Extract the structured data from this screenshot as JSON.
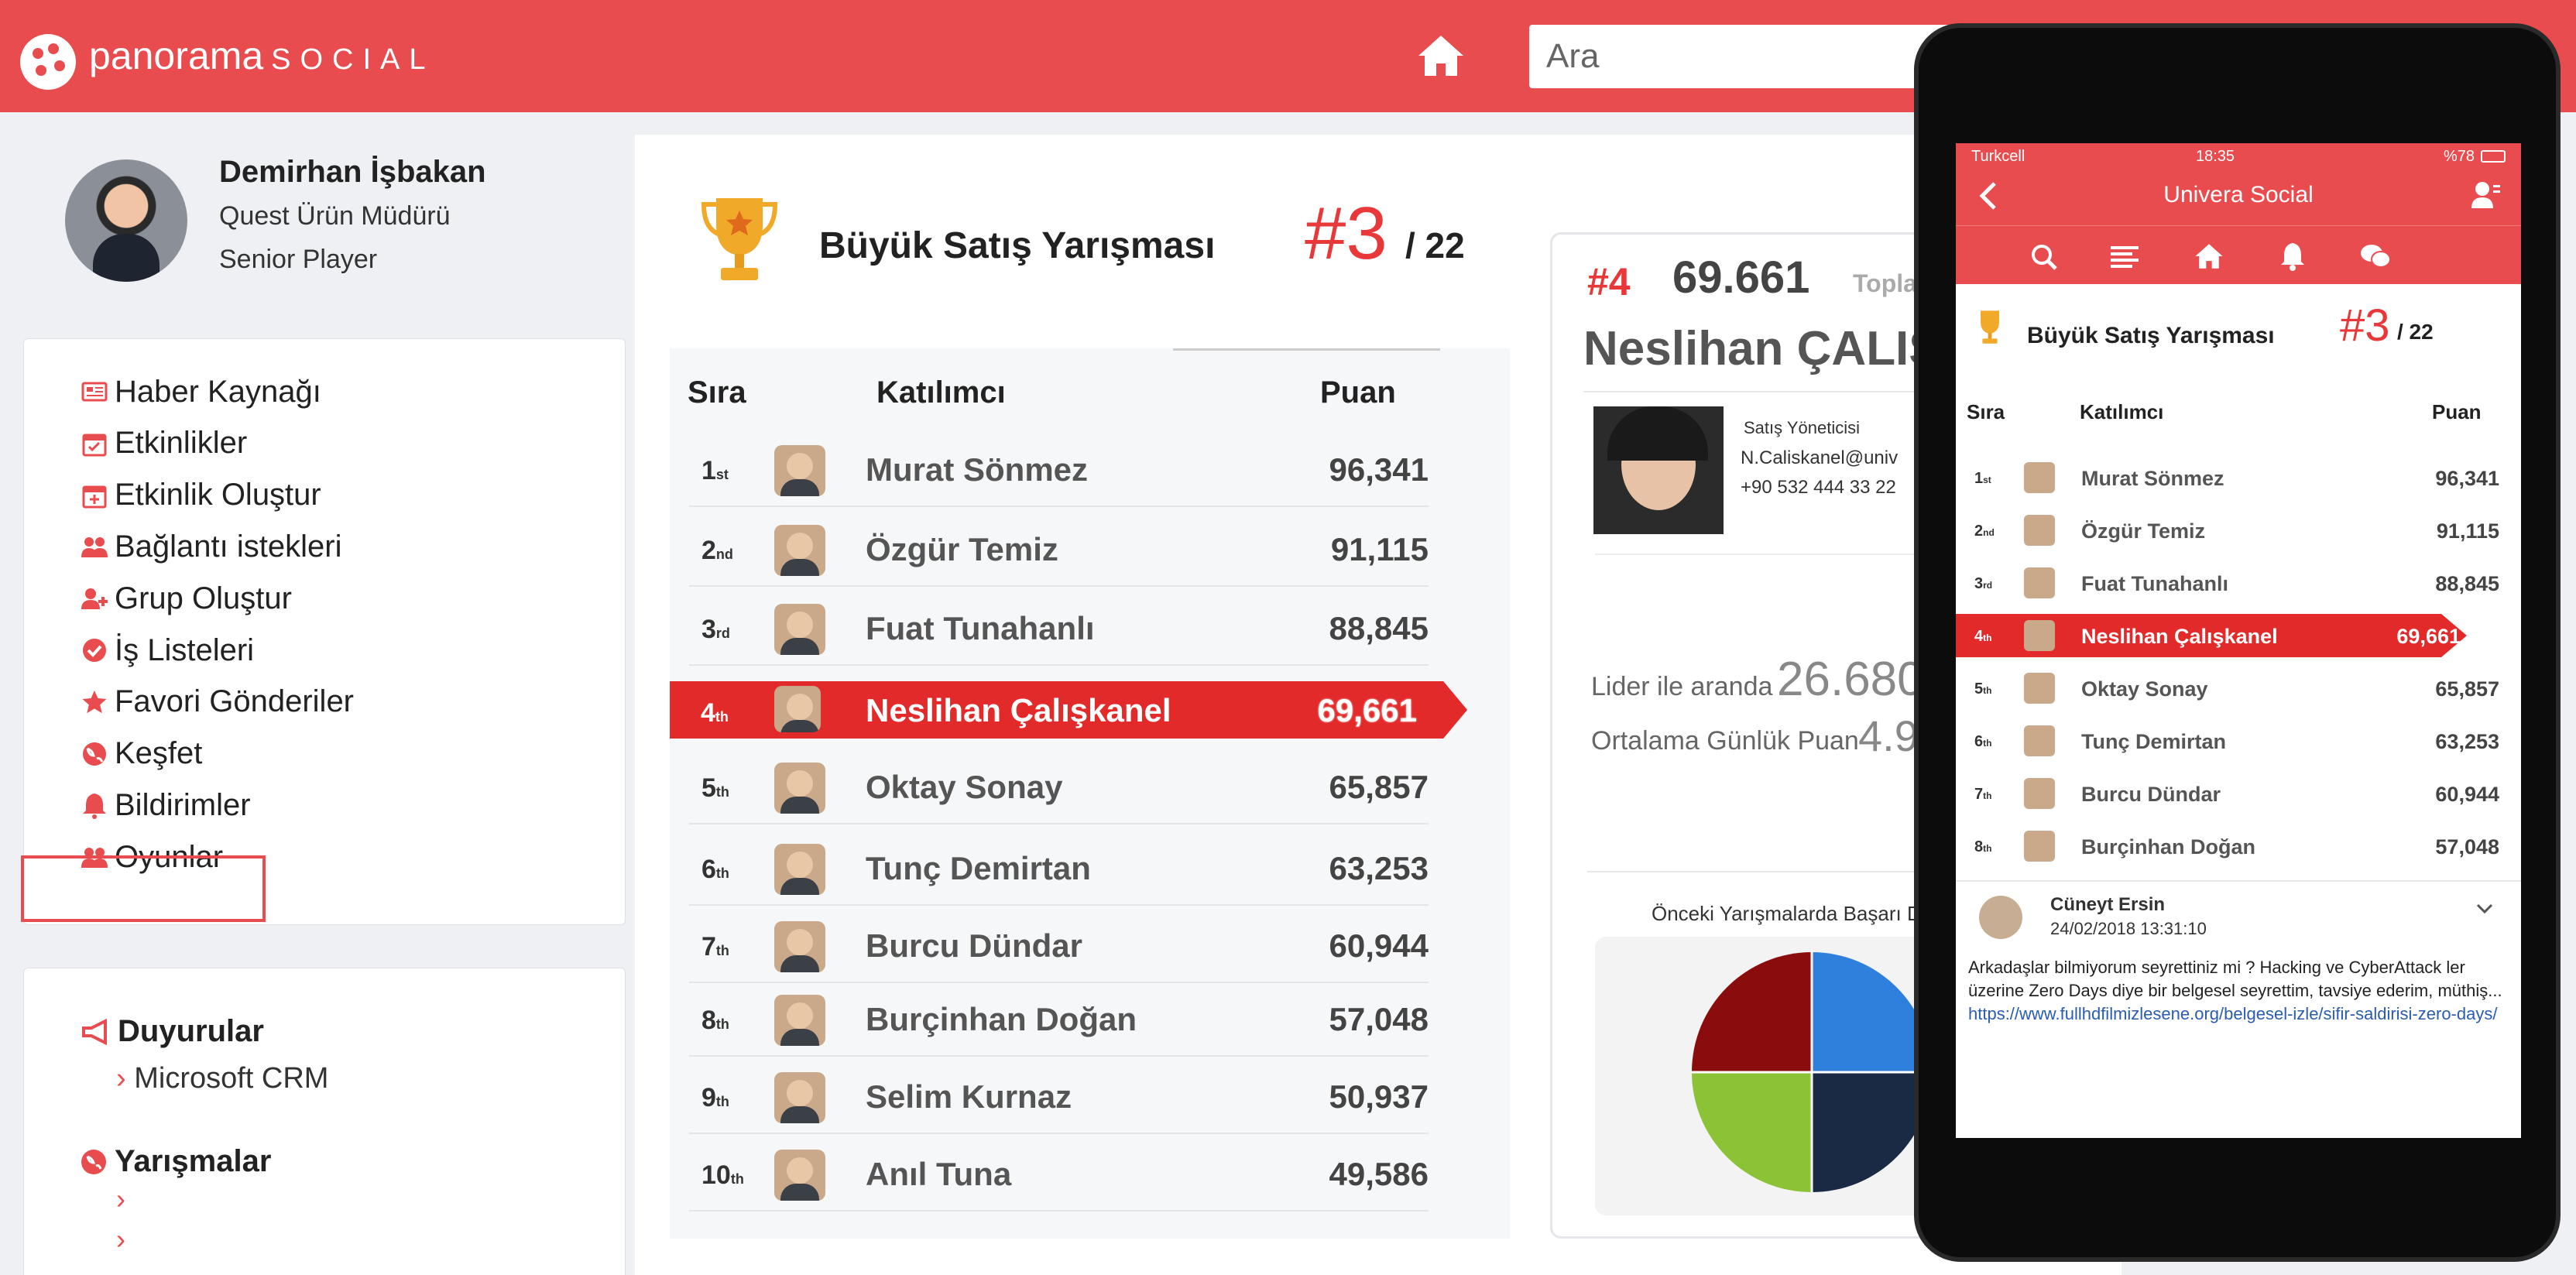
{
  "app": {
    "logo_main": "panorama",
    "logo_sub": "SOCIAL",
    "search_placeholder": "Ara"
  },
  "colors": {
    "brand": "#e94c4e",
    "highlight": "#e32a2a",
    "rank_accent": "#e8383a"
  },
  "profile": {
    "name": "Demirhan İşbakan",
    "title": "Quest Ürün Müdürü",
    "level": "Senior Player"
  },
  "menu": [
    {
      "label": "Haber Kaynağı",
      "icon": "newspaper-icon"
    },
    {
      "label": "Etkinlikler",
      "icon": "calendar-icon"
    },
    {
      "label": "Etkinlik Oluştur",
      "icon": "calendar-plus-icon"
    },
    {
      "label": "Bağlantı istekleri",
      "icon": "users-icon"
    },
    {
      "label": "Grup Oluştur",
      "icon": "user-plus-icon"
    },
    {
      "label": "İş Listeleri",
      "icon": "check-circle-icon"
    },
    {
      "label": "Favori Gönderiler",
      "icon": "star-icon"
    },
    {
      "label": "Keşfet",
      "icon": "globe-icon"
    },
    {
      "label": "Bildirimler",
      "icon": "bell-icon"
    },
    {
      "label": "Oyunlar",
      "icon": "users-icon",
      "selected": true
    }
  ],
  "announcements": {
    "title": "Duyurular",
    "links": [
      "Microsoft CRM"
    ]
  },
  "contests": {
    "title": "Yarışmalar"
  },
  "competition": {
    "title": "Büyük Satış Yarışması",
    "rank": "#3",
    "total": "/ 22"
  },
  "leaderboard": {
    "headers": {
      "rank": "Sıra",
      "participant": "Katılımcı",
      "points": "Puan"
    },
    "rows": [
      {
        "rank": "1",
        "suffix": "st",
        "name": "Murat Sönmez",
        "points": "96,341"
      },
      {
        "rank": "2",
        "suffix": "nd",
        "name": "Özgür Temiz",
        "points": "91,115"
      },
      {
        "rank": "3",
        "suffix": "rd",
        "name": "Fuat Tunahanlı",
        "points": "88,845"
      },
      {
        "rank": "4",
        "suffix": "th",
        "name": "Neslihan Çalışkanel",
        "points": "69,661",
        "highlight": true
      },
      {
        "rank": "5",
        "suffix": "th",
        "name": "Oktay Sonay",
        "points": "65,857"
      },
      {
        "rank": "6",
        "suffix": "th",
        "name": "Tunç Demirtan",
        "points": "63,253"
      },
      {
        "rank": "7",
        "suffix": "th",
        "name": "Burcu Dündar",
        "points": "60,944"
      },
      {
        "rank": "8",
        "suffix": "th",
        "name": "Burçinhan Doğan",
        "points": "57,048"
      },
      {
        "rank": "9",
        "suffix": "th",
        "name": "Selim Kurnaz",
        "points": "50,937"
      },
      {
        "rank": "10",
        "suffix": "th",
        "name": "Anıl Tuna",
        "points": "49,586"
      }
    ]
  },
  "detail": {
    "rank": "#4",
    "score": "69.661",
    "total_label": "Topla",
    "name": "Neslihan ÇALIŞ",
    "job": "Satış Yöneticisi",
    "email": "N.Caliskanel@univ",
    "phone": "+90 532 444 33 22",
    "lead_label": "Lider ile aranda",
    "lead_value": "26.680",
    "avg_label": "Ortalama Günlük Puan",
    "avg_value": "4.9",
    "chart_title": "Önceki Yarışmalarda Başarı D",
    "pie_colors": [
      "#2f7fdc",
      "#1b2a44",
      "#8bc236",
      "#8a0c0c"
    ]
  },
  "phone": {
    "carrier": "Turkcell",
    "time": "18:35",
    "battery": "%78",
    "app_title": "Univera Social",
    "competition_title": "Büyük Satış Yarışması",
    "rank": "#3",
    "total": "/ 22",
    "headers": {
      "rank": "Sıra",
      "participant": "Katılımcı",
      "points": "Puan"
    },
    "rows": [
      {
        "rank": "1",
        "suffix": "st",
        "name": "Murat Sönmez",
        "points": "96,341"
      },
      {
        "rank": "2",
        "suffix": "nd",
        "name": "Özgür Temiz",
        "points": "91,115"
      },
      {
        "rank": "3",
        "suffix": "rd",
        "name": "Fuat Tunahanlı",
        "points": "88,845"
      },
      {
        "rank": "4",
        "suffix": "th",
        "name": "Neslihan Çalışkanel",
        "points": "69,661",
        "highlight": true
      },
      {
        "rank": "5",
        "suffix": "th",
        "name": "Oktay Sonay",
        "points": "65,857"
      },
      {
        "rank": "6",
        "suffix": "th",
        "name": "Tunç Demirtan",
        "points": "63,253"
      },
      {
        "rank": "7",
        "suffix": "th",
        "name": "Burcu Dündar",
        "points": "60,944"
      },
      {
        "rank": "8",
        "suffix": "th",
        "name": "Burçinhan Doğan",
        "points": "57,048"
      }
    ],
    "post": {
      "author": "Cüneyt Ersin",
      "date": "24/02/2018 13:31:10",
      "text": "Arkadaşlar bilmiyorum seyrettiniz mi ? Hacking ve CyberAttack ler üzerine Zero Days diye bir belgesel seyrettim, tavsiye ederim, müthiş...",
      "link": "https://www.fullhdfilmizlesene.org/belgesel-izle/sifir-saldirisi-zero-days/"
    }
  }
}
